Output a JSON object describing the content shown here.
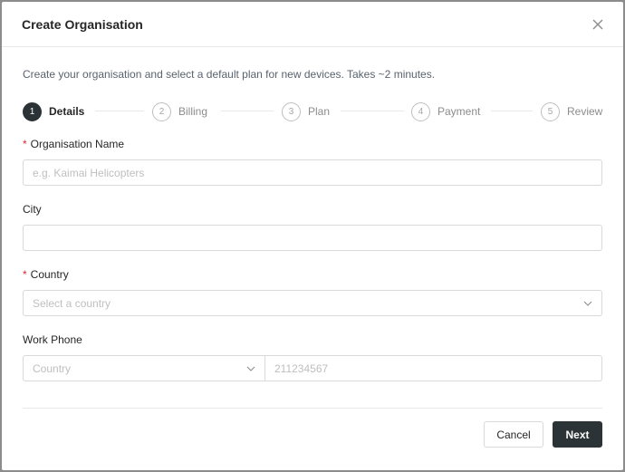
{
  "modal": {
    "title": "Create Organisation",
    "description": "Create your organisation and select a default plan for new devices. Takes ~2 minutes."
  },
  "steps": [
    {
      "number": "1",
      "label": "Details",
      "active": true
    },
    {
      "number": "2",
      "label": "Billing",
      "active": false
    },
    {
      "number": "3",
      "label": "Plan",
      "active": false
    },
    {
      "number": "4",
      "label": "Payment",
      "active": false
    },
    {
      "number": "5",
      "label": "Review",
      "active": false
    }
  ],
  "form": {
    "org_name": {
      "label": "Organisation Name",
      "required_mark": "*",
      "placeholder": "e.g. Kaimai Helicopters",
      "value": ""
    },
    "city": {
      "label": "City",
      "value": ""
    },
    "country": {
      "label": "Country",
      "required_mark": "*",
      "placeholder": "Select a country"
    },
    "work_phone": {
      "label": "Work Phone",
      "country_placeholder": "Country",
      "number_placeholder": "211234567"
    }
  },
  "footer": {
    "cancel_label": "Cancel",
    "next_label": "Next"
  },
  "icons": {
    "close": "close-icon",
    "chevron": "chevron-down-icon"
  },
  "colors": {
    "primary": "#2b3336",
    "required": "#e0282e",
    "border": "#d9d9d9"
  }
}
